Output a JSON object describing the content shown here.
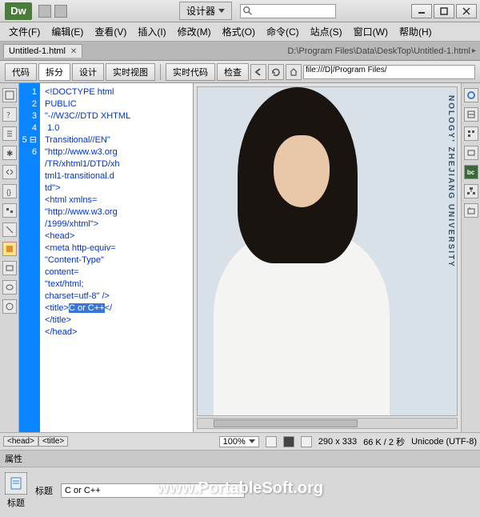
{
  "app": {
    "logo": "Dw"
  },
  "layout_selector": "设计器",
  "menu": [
    "文件(F)",
    "编辑(E)",
    "查看(V)",
    "插入(I)",
    "修改(M)",
    "格式(O)",
    "命令(C)",
    "站点(S)",
    "窗口(W)",
    "帮助(H)"
  ],
  "doc_tab": {
    "name": "Untitled-1.html"
  },
  "doc_path": "D:\\Program Files\\Data\\DeskTop\\Untitled-1.html",
  "toolbar": {
    "code": "代码",
    "split": "拆分",
    "design": "设计",
    "live_view": "实时视图",
    "live_code": "实时代码",
    "inspect": "检查",
    "url_prefix": "file:///D|/Program Files/"
  },
  "code": {
    "gutter_lines": [
      "1",
      "",
      "",
      "",
      "",
      "",
      "",
      "",
      "",
      "2",
      "",
      "",
      "3",
      "4",
      "",
      "",
      "",
      "",
      "5 ⊟",
      "",
      "6"
    ],
    "lines": [
      "<!DOCTYPE html",
      "PUBLIC",
      "\"-//W3C//DTD XHTML",
      " 1.0",
      "Transitional//EN\"",
      "\"http://www.w3.org",
      "/TR/xhtml1/DTD/xh",
      "tml1-transitional.d",
      "td\">",
      "<html xmlns=",
      "\"http://www.w3.org",
      "/1999/xhtml\">",
      "<head>",
      "<meta http-equiv=",
      "\"Content-Type\"",
      "content=",
      "\"text/html;",
      "charset=utf-8\" />"
    ],
    "title_open": "<title>",
    "title_text": "C or C++",
    "title_close": "</title>",
    "head_close": "</head>"
  },
  "preview_side_text": "NOLOGY' ZHEJIANG UNIVERSITY",
  "status": {
    "tag1": "<head>",
    "tag2": "<title>",
    "zoom": "100%",
    "dimensions": "290 x 333",
    "size_speed": "66 K / 2 秒",
    "encoding": "Unicode (UTF-8)"
  },
  "props": {
    "panel_title": "属性",
    "icon_label": "标题",
    "field_label": "标题",
    "field_value": "C or C++"
  },
  "watermark": "www.PortableSoft.org"
}
